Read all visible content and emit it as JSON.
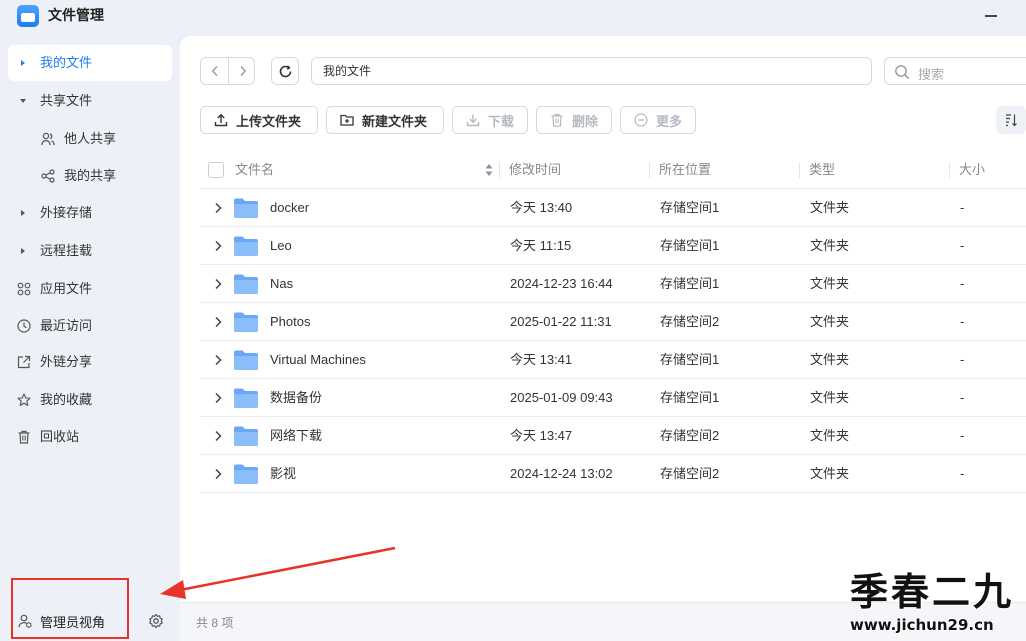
{
  "window": {
    "title": "文件管理"
  },
  "sidebar": {
    "items": [
      {
        "label": "我的文件",
        "active": true
      },
      {
        "label": "共享文件"
      },
      {
        "label": "他人共享"
      },
      {
        "label": "我的共享"
      },
      {
        "label": "外接存储"
      },
      {
        "label": "远程挂载"
      },
      {
        "label": "应用文件"
      },
      {
        "label": "最近访问"
      },
      {
        "label": "外链分享"
      },
      {
        "label": "我的收藏"
      },
      {
        "label": "回收站"
      }
    ],
    "admin_view": "管理员视角"
  },
  "toolbar": {
    "path": "我的文件",
    "search_placeholder": "搜索",
    "buttons": {
      "upload": "上传文件夹",
      "new_folder": "新建文件夹",
      "download": "下载",
      "delete": "删除",
      "more": "更多"
    }
  },
  "table": {
    "columns": [
      "文件名",
      "修改时间",
      "所在位置",
      "类型",
      "大小"
    ],
    "rows": [
      {
        "name": "docker",
        "modified": "今天 13:40",
        "location": "存储空间1",
        "type": "文件夹",
        "size": "-"
      },
      {
        "name": "Leo",
        "modified": "今天 11:15",
        "location": "存储空间1",
        "type": "文件夹",
        "size": "-"
      },
      {
        "name": "Nas",
        "modified": "2024-12-23 16:44",
        "location": "存储空间1",
        "type": "文件夹",
        "size": "-"
      },
      {
        "name": "Photos",
        "modified": "2025-01-22 11:31",
        "location": "存储空间2",
        "type": "文件夹",
        "size": "-"
      },
      {
        "name": "Virtual Machines",
        "modified": "今天 13:41",
        "location": "存储空间1",
        "type": "文件夹",
        "size": "-"
      },
      {
        "name": "数据备份",
        "modified": "2025-01-09 09:43",
        "location": "存储空间1",
        "type": "文件夹",
        "size": "-"
      },
      {
        "name": "网络下载",
        "modified": "今天 13:47",
        "location": "存储空间2",
        "type": "文件夹",
        "size": "-"
      },
      {
        "name": "影视",
        "modified": "2024-12-24 13:02",
        "location": "存储空间2",
        "type": "文件夹",
        "size": "-"
      }
    ]
  },
  "status": {
    "count_text": "共 8 项"
  },
  "watermark": {
    "title": "季春二九",
    "url": "www.jichun29.cn"
  },
  "colors": {
    "accent": "#1f7cf0",
    "folder": "#6aa8f7",
    "annotation": "#e8332a"
  }
}
